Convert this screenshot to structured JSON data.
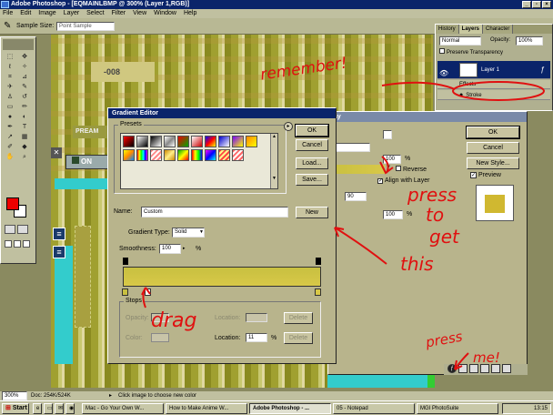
{
  "titlebar": {
    "title": "Adobe Photoshop - [EQMAINLBMP @ 300% (Layer 1,RGB)]"
  },
  "menu": [
    "File",
    "Edit",
    "Image",
    "Layer",
    "Select",
    "Filter",
    "View",
    "Window",
    "Help"
  ],
  "options": {
    "sample_label": "Sample Size:",
    "sample_value": "Point Sample"
  },
  "canvas": {
    "on_label": "ON",
    "num_label": "-008",
    "preamp_label": "PREAM"
  },
  "layers_panel": {
    "tabs": [
      "History",
      "Layers",
      "Character"
    ],
    "blend_mode": "Normal",
    "opacity_label": "Opacity:",
    "opacity_value": "100%",
    "preserve_label": "Preserve Transparency",
    "layer_name": "Layer 1",
    "effects_label": "Effects",
    "stroke_label": "Stroke"
  },
  "back_dialog": {
    "title_fragment": "ay",
    "ok": "OK",
    "cancel": "Cancel",
    "new_style": "New Style...",
    "preview": "Preview",
    "pct1": "100",
    "pct_sign": "%",
    "reverse": "Reverse",
    "align": "Align with Layer",
    "angle": "90",
    "pct2": "100"
  },
  "gradient_editor": {
    "title": "Gradient Editor",
    "presets_label": "Presets",
    "ok": "OK",
    "cancel": "Cancel",
    "load": "Load...",
    "save": "Save...",
    "name_label": "Name:",
    "name_value": "Custom",
    "new": "New",
    "gradient_type_label": "Gradient Type:",
    "gradient_type_value": "Solid",
    "smoothness_label": "Smoothness:",
    "smoothness_value": "100",
    "smoothness_unit": "%",
    "stops_label": "Stops",
    "opacity_label": "Opacity:",
    "color_label": "Color:",
    "location_label": "Location:",
    "location_value": "11",
    "location_unit": "%",
    "delete": "Delete"
  },
  "annotations": {
    "remember": "remember!",
    "press_to": "press",
    "to": "to",
    "get": "get",
    "this": "this",
    "drag": "drag",
    "press_me_1": "press",
    "press_me_2": "me!"
  },
  "status": {
    "zoom": "300%",
    "doc": "Doc: 254K/524K",
    "hint": "Click image to choose new color"
  },
  "taskbar": {
    "start": "Start",
    "tasks": [
      "Mac - Go Your Own W...",
      "How to Make Anime W...",
      "Adobe Photoshop - ...",
      "05 - Notepad",
      "MGI PhotoSuite"
    ],
    "clock": "13:15"
  },
  "colors": {
    "accent": "#0a246a",
    "annotation": "#e01010",
    "gradient_start": "#c8c040",
    "gradient_end": "#d8c848"
  }
}
